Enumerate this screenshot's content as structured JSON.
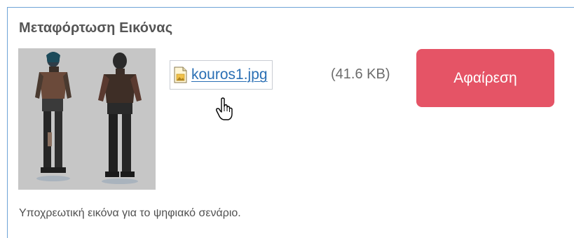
{
  "panel": {
    "title": "Μεταφόρτωση Εικόνας",
    "file": {
      "name": "kouros1.jpg",
      "size": "(41.6 KB)",
      "icon": "image-file-icon"
    },
    "remove_label": "Αφαίρεση",
    "note": "Υποχρεωτική εικόνα για το ψηφιακό σενάριο."
  },
  "colors": {
    "border": "#6ea3d6",
    "link": "#2a6fb4",
    "danger": "#e55466"
  },
  "cursor": "hand-pointer-icon"
}
